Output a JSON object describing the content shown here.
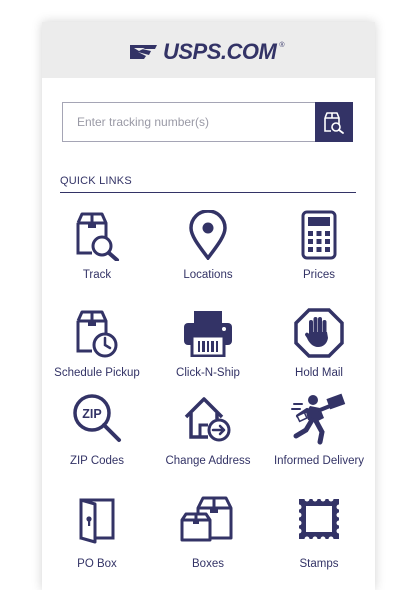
{
  "header": {
    "logo_text": "USPS.COM",
    "logo_reg": "®"
  },
  "search": {
    "placeholder": "Enter tracking number(s)",
    "value": ""
  },
  "quick_links": {
    "heading": "QUICK LINKS",
    "items": [
      {
        "label": "Track",
        "icon": "track-package-icon"
      },
      {
        "label": "Locations",
        "icon": "location-pin-icon"
      },
      {
        "label": "Prices",
        "icon": "calculator-icon"
      },
      {
        "label": "Schedule Pickup",
        "icon": "schedule-pickup-icon"
      },
      {
        "label": "Click-N-Ship",
        "icon": "printer-icon"
      },
      {
        "label": "Hold Mail",
        "icon": "hold-hand-icon"
      },
      {
        "label": "ZIP Codes",
        "icon": "zip-magnifier-icon"
      },
      {
        "label": "Change Address",
        "icon": "change-address-icon"
      },
      {
        "label": "Informed Delivery",
        "icon": "mail-carrier-icon"
      },
      {
        "label": "PO Box",
        "icon": "po-box-icon"
      },
      {
        "label": "Boxes",
        "icon": "boxes-icon"
      },
      {
        "label": "Stamps",
        "icon": "stamp-icon"
      }
    ]
  },
  "colors": {
    "brand": "#333366",
    "header_bg": "#ececec"
  }
}
